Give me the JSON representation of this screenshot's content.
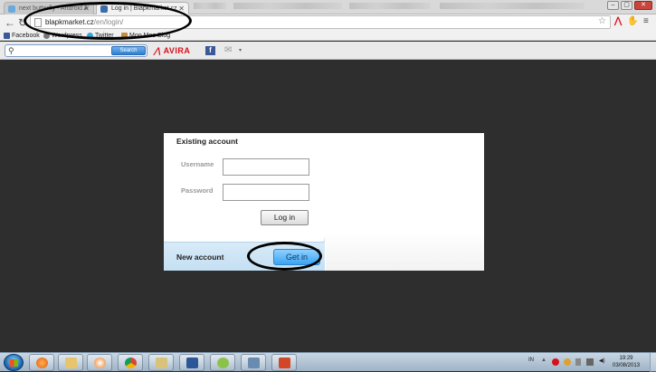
{
  "browser": {
    "tabs": [
      {
        "title": "next butterfly - Android A",
        "active": false
      },
      {
        "title": "Log in | Blapkmarket.cz",
        "active": true
      }
    ],
    "window_buttons": {
      "minimize": "–",
      "maximize": "▢",
      "close": "✕"
    },
    "url_host": "blapkmarket.cz",
    "url_path": "/en/login/",
    "bookmarks": [
      "Facebook",
      "Wordpress",
      "Twitter",
      "Moo Moo Blog"
    ]
  },
  "avira_toolbar": {
    "search_placeholder": "",
    "search_button": "Search",
    "brand": "AVIRA"
  },
  "login": {
    "existing_title": "Existing account",
    "username_label": "Username",
    "password_label": "Password",
    "username_value": "",
    "password_value": "",
    "login_button": "Log in",
    "new_account_title": "New account",
    "get_in_button": "Get in"
  },
  "taskbar": {
    "language": "IN",
    "time": "19:29",
    "date": "03/08/2013"
  },
  "colors": {
    "page_bg": "#2e2e2e",
    "get_in_button": "#3aa4f3",
    "avira_red": "#d7111b",
    "new_account_bg": "#c4dff3"
  }
}
